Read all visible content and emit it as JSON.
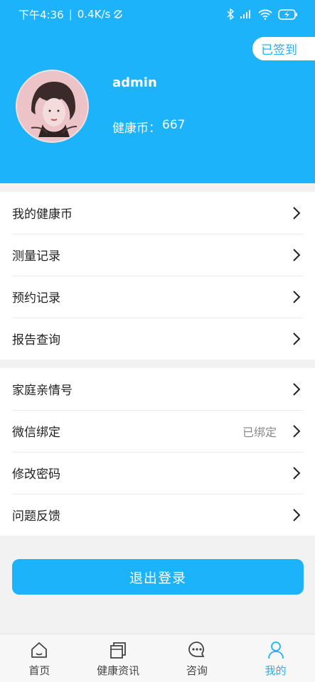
{
  "statusbar": {
    "time": "下午4:36",
    "speed": "0.4K/s",
    "divider": "|"
  },
  "header": {
    "signin_status": "已签到",
    "username": "admin",
    "coin_label": "健康币：",
    "coin_value": "667"
  },
  "menu_group_1": [
    {
      "label": "我的健康币"
    },
    {
      "label": "测量记录"
    },
    {
      "label": "预约记录"
    },
    {
      "label": "报告查询"
    }
  ],
  "menu_group_2": [
    {
      "label": "家庭亲情号",
      "value": ""
    },
    {
      "label": "微信绑定",
      "value": "已绑定"
    },
    {
      "label": "修改密码",
      "value": ""
    },
    {
      "label": "问题反馈",
      "value": ""
    }
  ],
  "logout_label": "退出登录",
  "tabs": [
    {
      "label": "首页",
      "icon": "home-icon"
    },
    {
      "label": "健康资讯",
      "icon": "news-icon"
    },
    {
      "label": "咨询",
      "icon": "chat-icon"
    },
    {
      "label": "我的",
      "icon": "person-icon"
    }
  ],
  "colors": {
    "accent": "#1cb3fb",
    "background": "#f2f2f2"
  }
}
